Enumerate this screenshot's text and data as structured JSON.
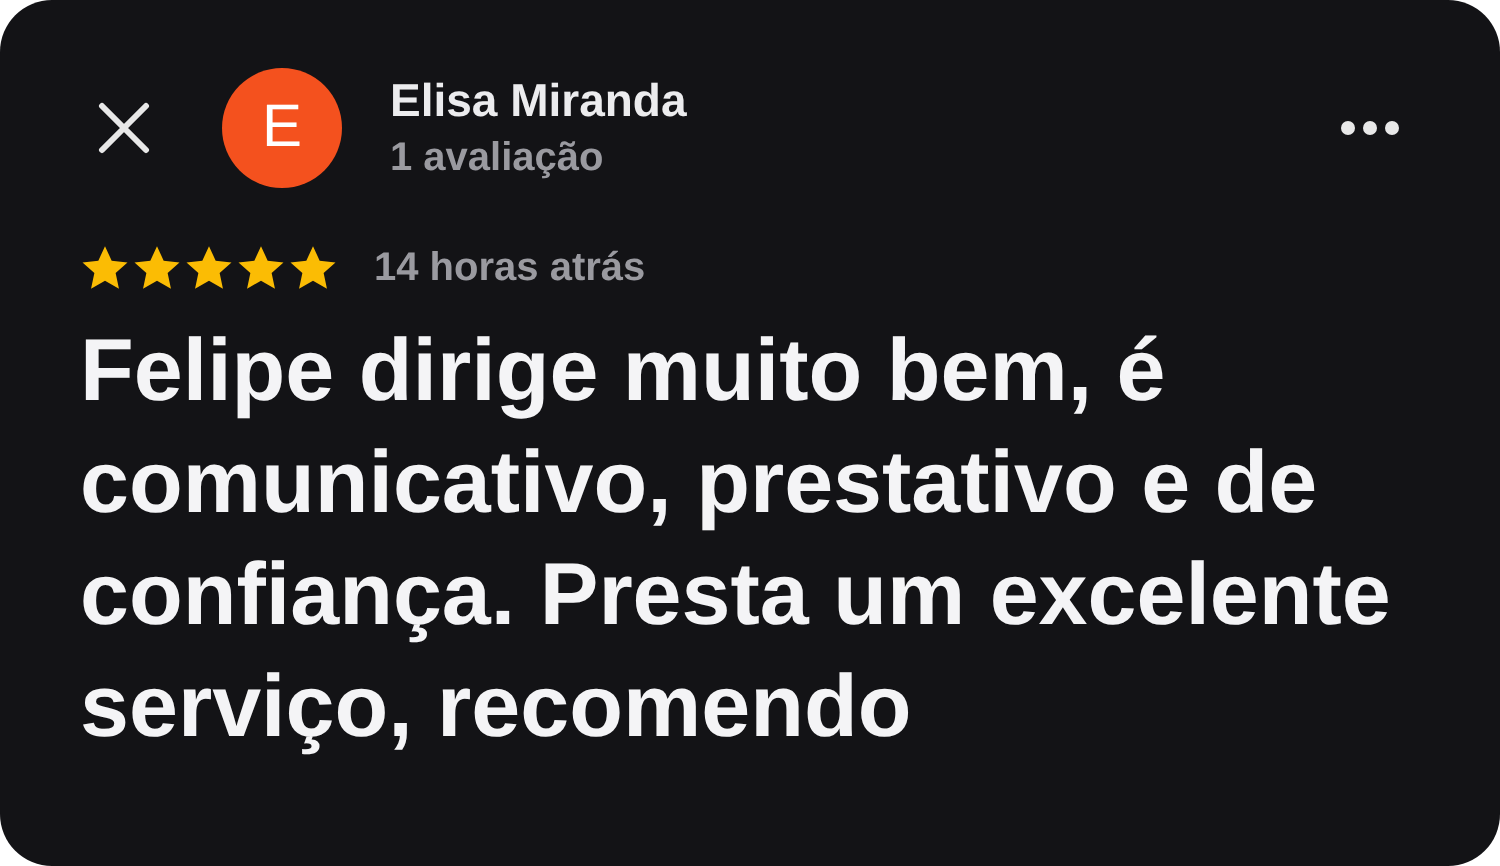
{
  "reviewer": {
    "initial": "E",
    "name": "Elisa Miranda",
    "review_count": "1 avaliação"
  },
  "rating": {
    "stars": 5,
    "time": "14 horas atrás"
  },
  "review_text": "Felipe dirige muito bem, é comunicativo, prestativo e de confiança. Presta um excelente serviço, recomendo"
}
